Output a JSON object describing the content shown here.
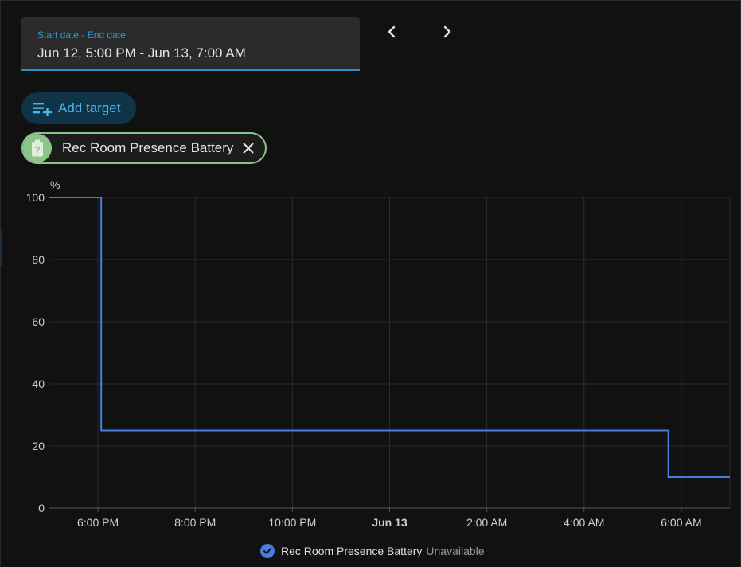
{
  "date_range": {
    "label": "Start date - End date",
    "value": "Jun 12, 5:00 PM - Jun 13, 7:00 AM"
  },
  "nav": {
    "prev_icon": "chevron-left-icon",
    "next_icon": "chevron-right-icon"
  },
  "add_target": {
    "label": "Add target",
    "icon": "playlist-plus-icon"
  },
  "target_chip": {
    "label": "Rec Room Presence Battery",
    "icon": "battery-unknown-icon",
    "remove_icon": "close-icon",
    "color": "#8cc58a"
  },
  "legend": {
    "name": "Rec Room Presence Battery",
    "state": "Unavailable"
  },
  "colors": {
    "accent": "#2b9ad6",
    "line": "#4a7be0",
    "grid": "#2c2c2c"
  },
  "chart_data": {
    "type": "line",
    "step": true,
    "ylabel": "%",
    "ylim": [
      0,
      100
    ],
    "yticks": [
      0,
      20,
      40,
      60,
      80,
      100
    ],
    "xlim": [
      "2023-06-12T17:00",
      "2023-06-13T07:00"
    ],
    "xticks": [
      {
        "label": "6:00 PM",
        "t": "2023-06-12T18:00",
        "bold": false
      },
      {
        "label": "8:00 PM",
        "t": "2023-06-12T20:00",
        "bold": false
      },
      {
        "label": "10:00 PM",
        "t": "2023-06-12T22:00",
        "bold": false
      },
      {
        "label": "Jun 13",
        "t": "2023-06-13T00:00",
        "bold": true
      },
      {
        "label": "2:00 AM",
        "t": "2023-06-13T02:00",
        "bold": false
      },
      {
        "label": "4:00 AM",
        "t": "2023-06-13T04:00",
        "bold": false
      },
      {
        "label": "6:00 AM",
        "t": "2023-06-13T06:00",
        "bold": false
      }
    ],
    "series": [
      {
        "name": "Rec Room Presence Battery",
        "points": [
          {
            "t": "2023-06-12T17:00",
            "y": 100
          },
          {
            "t": "2023-06-12T18:04",
            "y": 25
          },
          {
            "t": "2023-06-13T05:44",
            "y": 10
          },
          {
            "t": "2023-06-13T07:00",
            "y": 10
          }
        ]
      }
    ],
    "grid": true
  }
}
